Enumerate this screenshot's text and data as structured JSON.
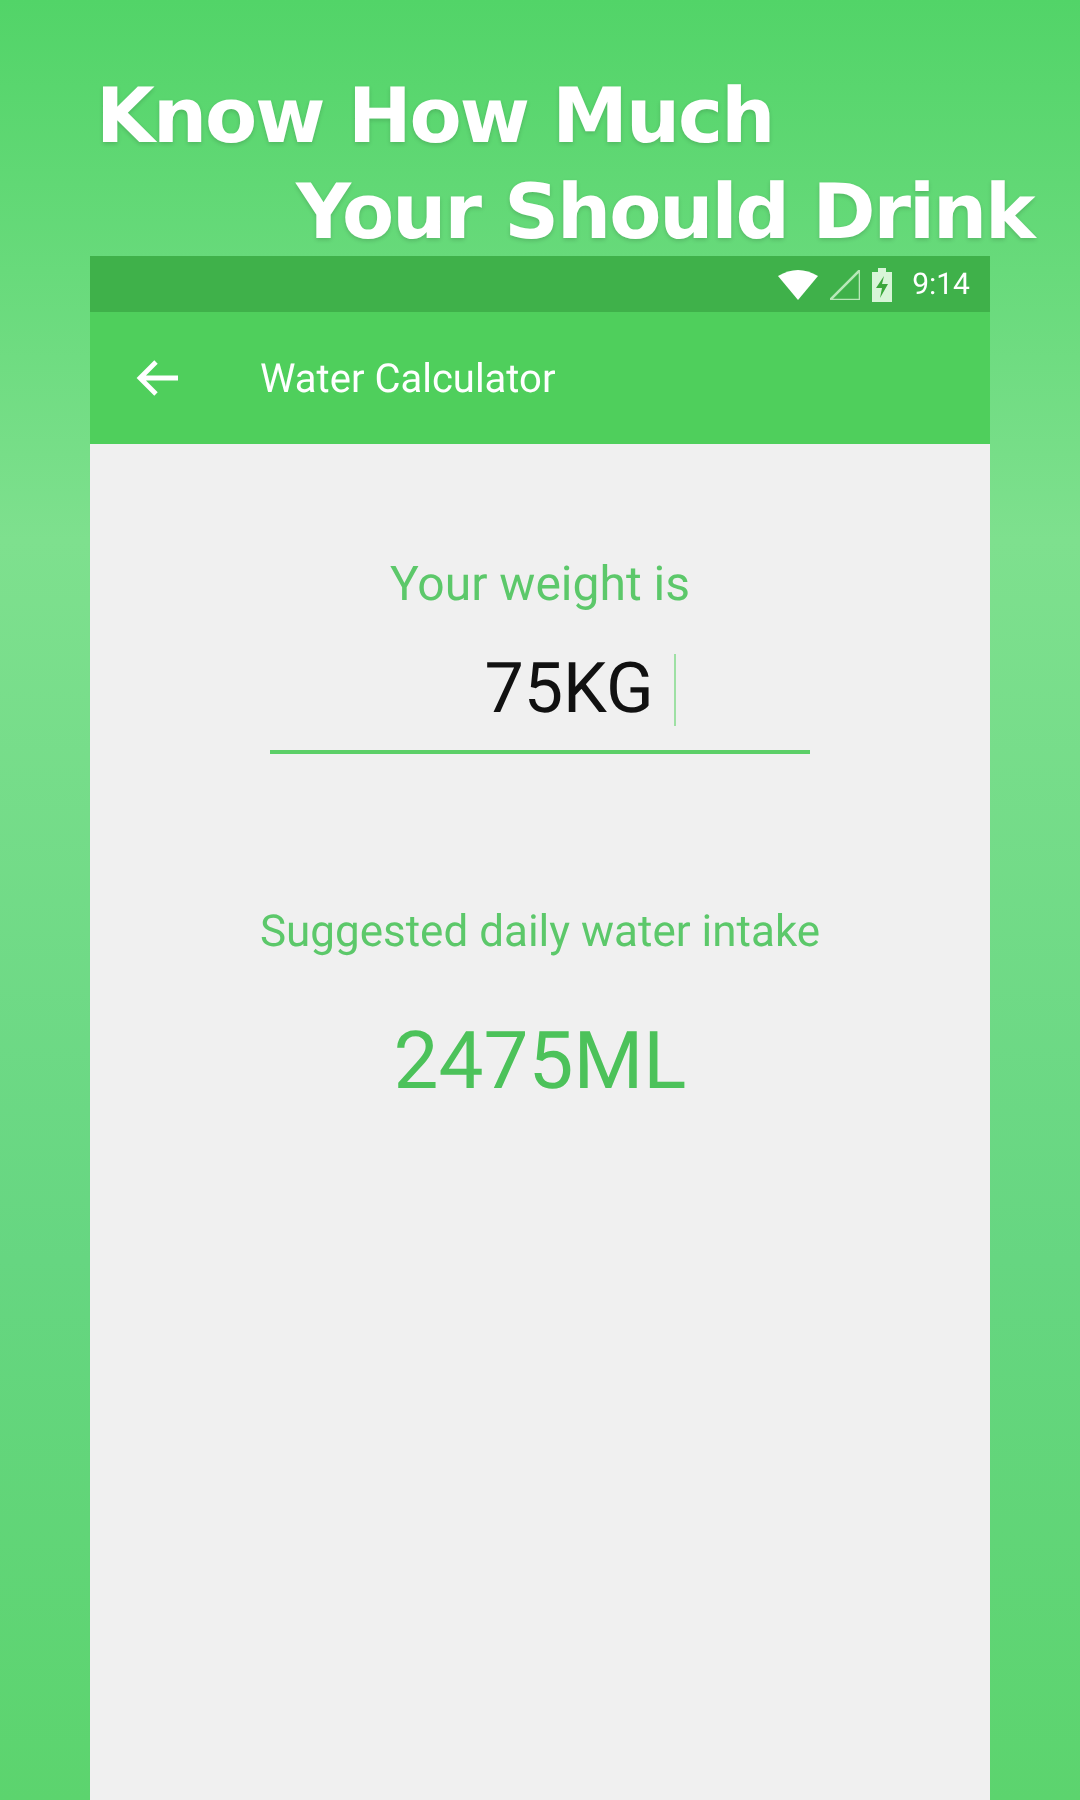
{
  "headline": [
    "Know How Much",
    "Your Should Drink"
  ],
  "status_bar": {
    "time": "9:14"
  },
  "app_bar": {
    "title": "Water Calculator"
  },
  "weight": {
    "label": "Your weight is",
    "value": "75KG"
  },
  "result": {
    "label": "Suggested daily water intake",
    "value": "2475ML"
  }
}
